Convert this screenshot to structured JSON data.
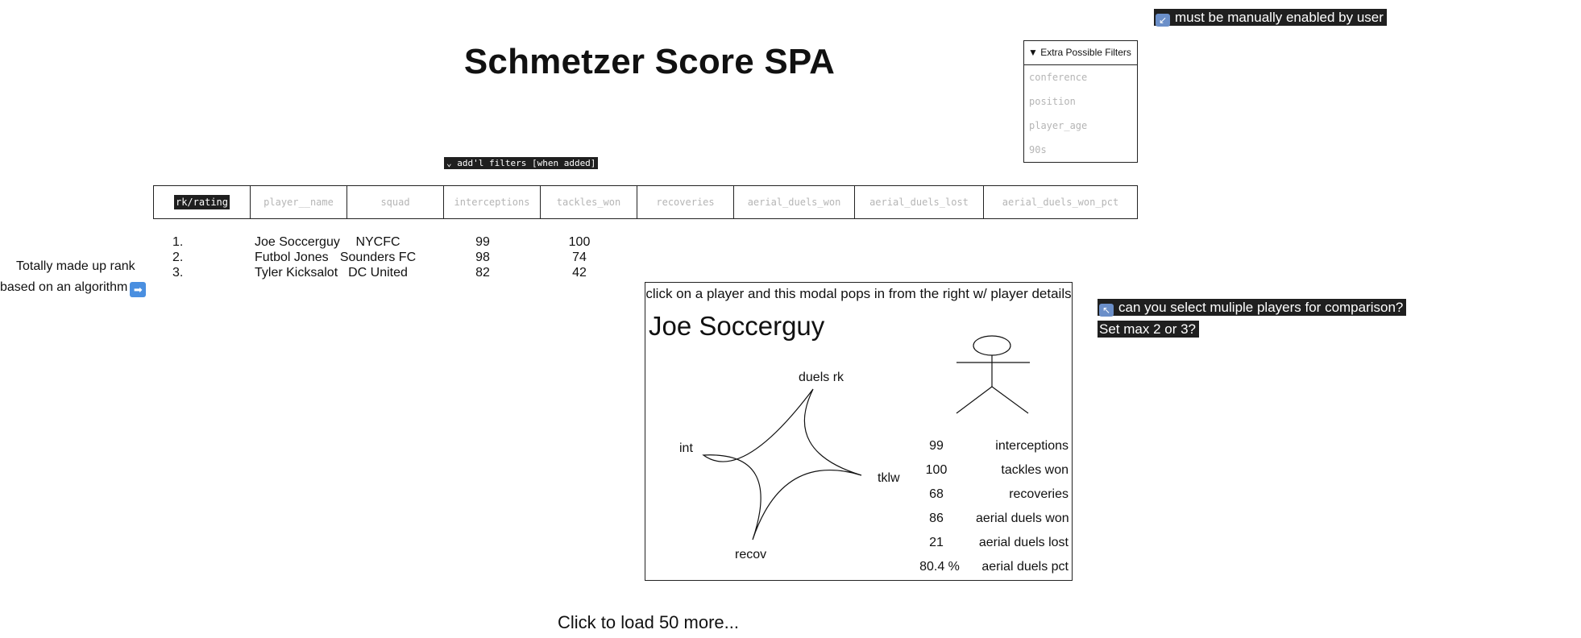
{
  "page_title": "Schmetzer Score SPA",
  "top_note": {
    "icon": "diagonal-arrow-icon",
    "text": "must be manually enabled by user"
  },
  "extra_filters": {
    "header": "▼ Extra Possible Filters",
    "items": [
      "conference",
      "position",
      "player_age",
      "90s"
    ]
  },
  "addl_filters_label": "⌄ add'l filters [when added]",
  "columns": [
    "rk/rating",
    "player__name",
    "squad",
    "interceptions",
    "tackles_won",
    "recoveries",
    "aerial_duels_won",
    "aerial_duels_lost",
    "aerial_duels_won_pct"
  ],
  "rows": [
    {
      "rank": "1.",
      "name": "Joe Soccerguy",
      "squad": "NYCFC",
      "interceptions": "99",
      "tackles_won": "100"
    },
    {
      "rank": "2.",
      "name": "Futbol Jones",
      "squad": "Sounders FC",
      "interceptions": "98",
      "tackles_won": "74"
    },
    {
      "rank": "3.",
      "name": "Tyler Kicksalot",
      "squad": "DC United",
      "interceptions": "82",
      "tackles_won": "42"
    }
  ],
  "rank_note": {
    "line1": "Totally made up rank",
    "line2": "based on an algorithm",
    "icon": "right-arrow-icon"
  },
  "modal": {
    "caption": "click on a player and this modal pops in from the right w/ player details",
    "player_name": "Joe Soccerguy",
    "radar_labels": {
      "top": "duels rk",
      "left": "int",
      "right": "tklw",
      "bottom": "recov"
    },
    "stats": [
      {
        "value": "99",
        "label": "interceptions"
      },
      {
        "value": "100",
        "label": "tackles won"
      },
      {
        "value": "68",
        "label": "recoveries"
      },
      {
        "value": "86",
        "label": "aerial duels won"
      },
      {
        "value": "21",
        "label": "aerial duels lost"
      },
      {
        "value": "80.4 %",
        "label": "aerial duels pct"
      }
    ]
  },
  "compare_note": {
    "icon": "diagonal-arrow-icon",
    "line1": "can you select muliple players for comparison?",
    "line2": "Set max 2 or 3?"
  },
  "load_more": "Click to load 50 more..."
}
